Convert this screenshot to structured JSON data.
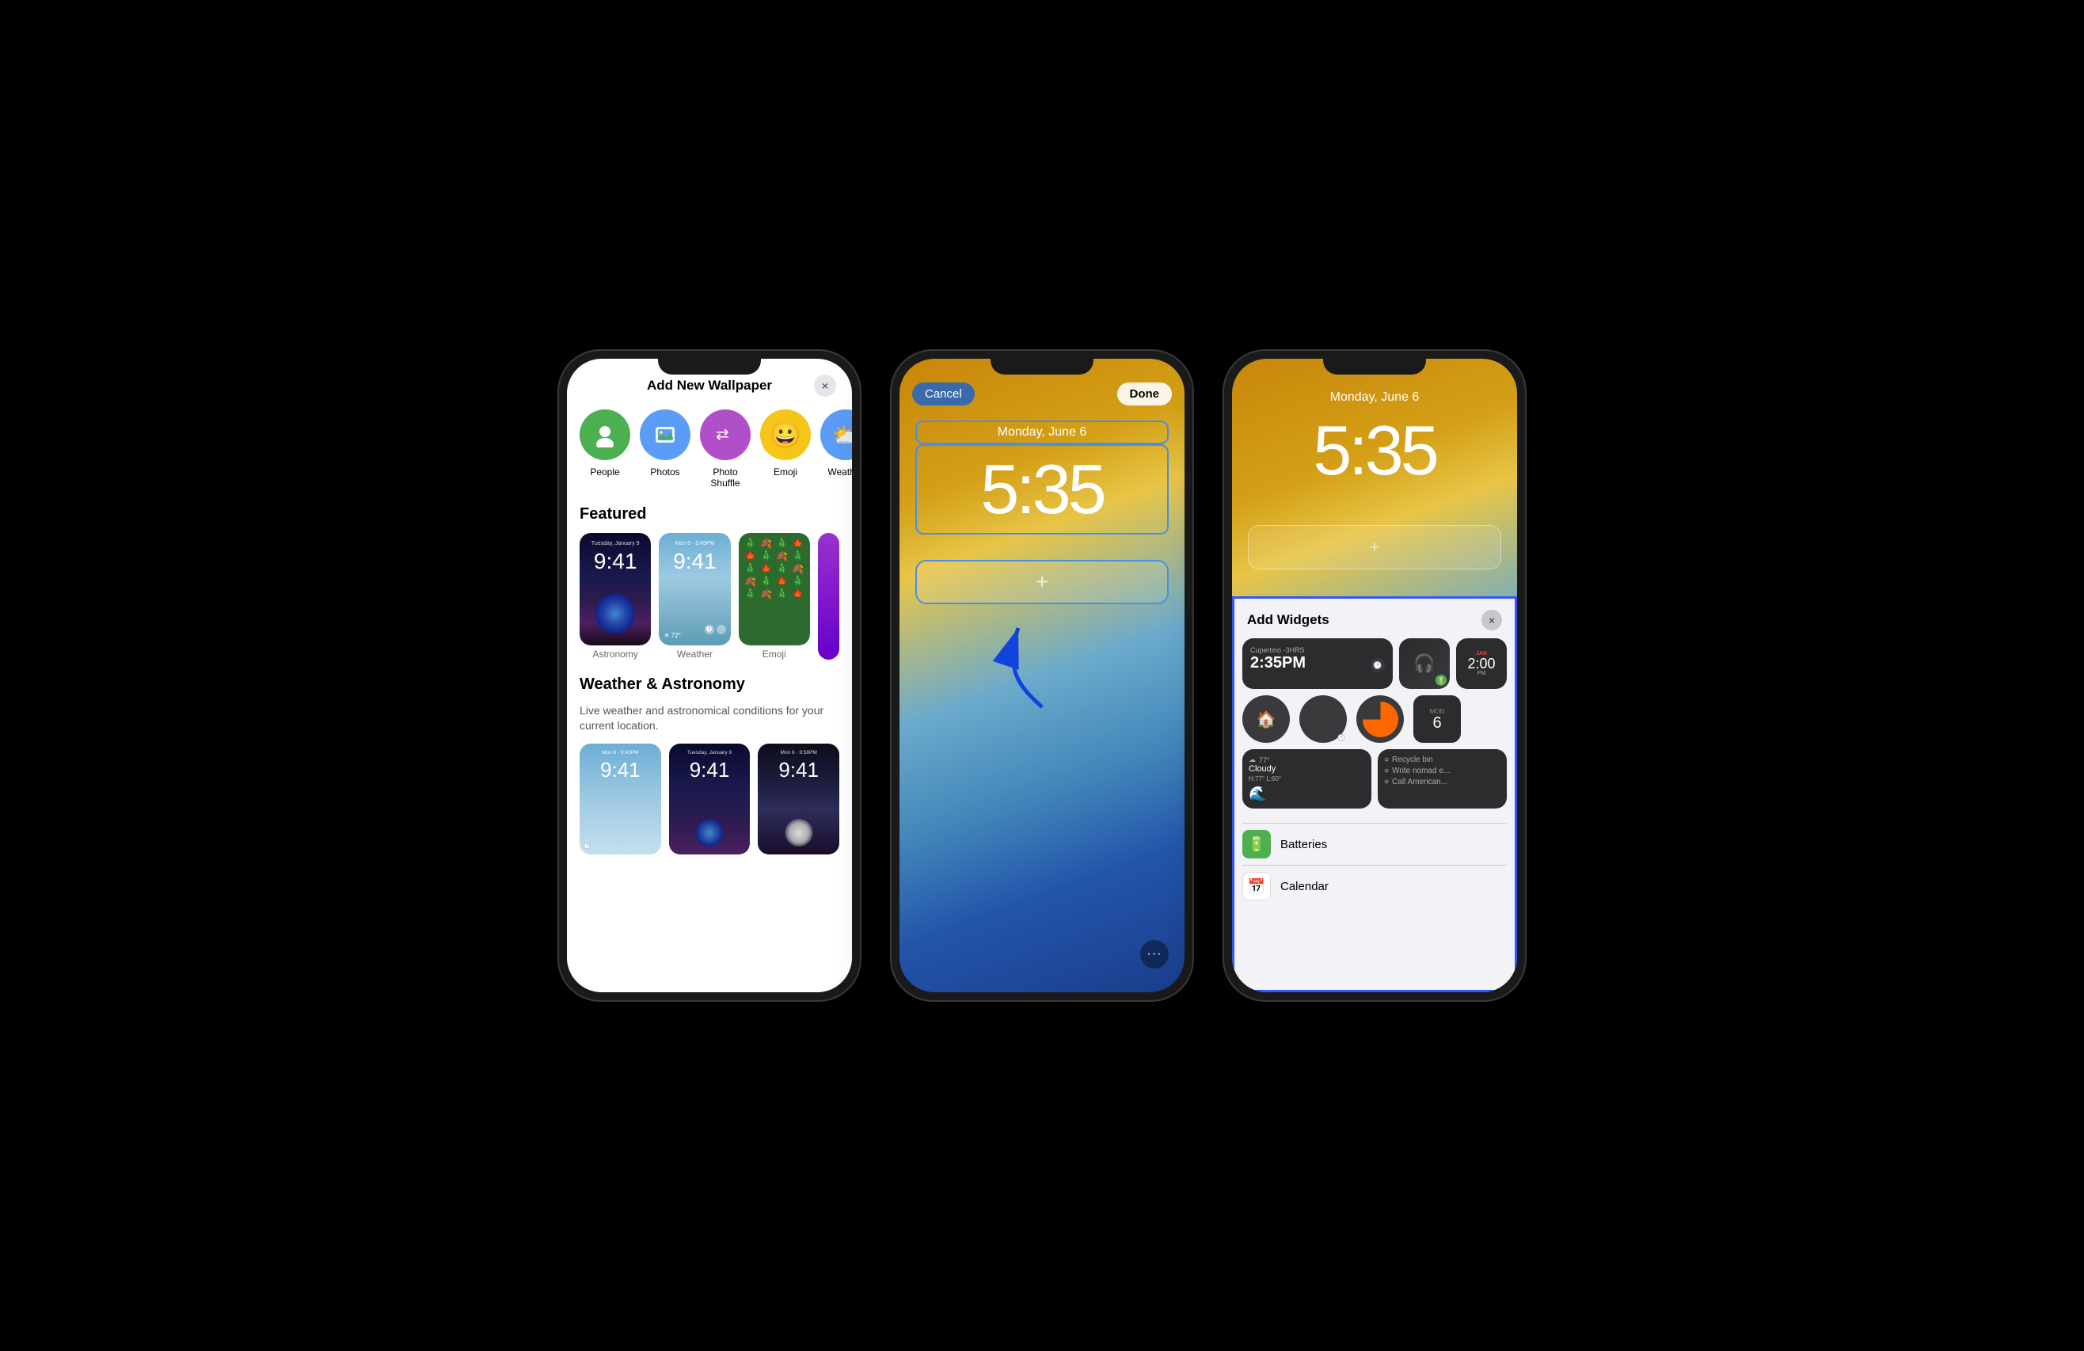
{
  "phone1": {
    "modal_title": "Add New Wallpaper",
    "close_icon": "×",
    "types": [
      {
        "label": "People",
        "bg": "#4caf50",
        "emoji": "👤"
      },
      {
        "label": "Photos",
        "bg": "#5b9cf6",
        "emoji": "🖼"
      },
      {
        "label": "Photo Shuffle",
        "bg": "#b04fc8",
        "emoji": "⇄"
      },
      {
        "label": "Emoji",
        "bg": "#f5c518",
        "emoji": "😀"
      },
      {
        "label": "Weather",
        "bg": "#5b9cf6",
        "emoji": "☁"
      }
    ],
    "featured_label": "Featured",
    "featured_items": [
      {
        "label": "Astronomy"
      },
      {
        "label": "Weather"
      },
      {
        "label": "Emoji"
      }
    ],
    "weather_section_title": "Weather & Astronomy",
    "weather_section_subtitle": "Live weather and astronomical conditions for your current location.",
    "date_text": "Tuesday, January 9",
    "time_text": "9:41",
    "mon_june6": "Mon 6 · 9:45PM"
  },
  "phone2": {
    "cancel_label": "Cancel",
    "done_label": "Done",
    "date_label": "Monday, June 6",
    "time_label": "5:35",
    "plus_icon": "+",
    "dots_icon": "···"
  },
  "phone3": {
    "date_label": "Monday, June 6",
    "time_label": "5:35",
    "panel_title": "Add Widgets",
    "close_icon": "×",
    "plus_icon": "+",
    "widget1_location": "Cupertino -3HRS",
    "widget1_time": "2:35PM",
    "widget3_time": "2:00",
    "widget3_sub": "PM",
    "weather_temp": "77°",
    "weather_condition": "Cloudy",
    "weather_range": "H:77° L:60°",
    "reminder1": "Recycle bin",
    "reminder2": "Write nomad e...",
    "reminder3": "Call American...",
    "app1_label": "Batteries",
    "app2_label": "Calendar"
  }
}
